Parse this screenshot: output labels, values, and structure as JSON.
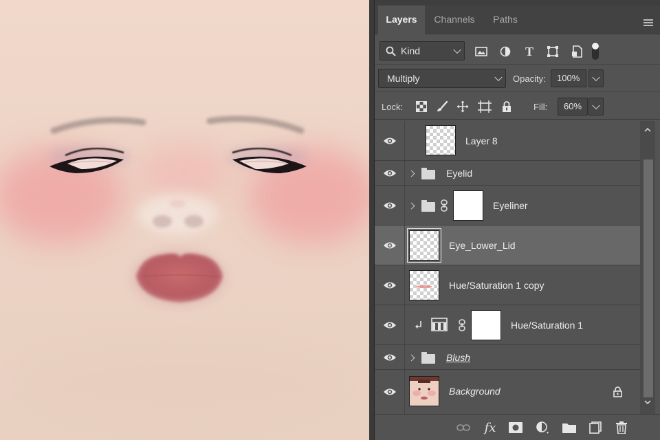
{
  "panel": {
    "tabs": [
      {
        "label": "Layers",
        "active": true
      },
      {
        "label": "Channels",
        "active": false
      },
      {
        "label": "Paths",
        "active": false
      }
    ],
    "filter": {
      "kind_label": "Kind",
      "filter_icons": [
        "image-filter-icon",
        "adjustment-filter-icon",
        "type-filter-icon",
        "shape-filter-icon",
        "smart-object-filter-icon",
        "filter-toggle-icon"
      ]
    },
    "blend": {
      "mode": "Multiply",
      "opacity_label": "Opacity:",
      "opacity_value": "100%"
    },
    "lock": {
      "label": "Lock:",
      "icons": [
        "lock-transparent-pixels-icon",
        "lock-image-pixels-icon",
        "lock-position-icon",
        "lock-artboard-icon",
        "lock-all-icon"
      ],
      "fill_label": "Fill:",
      "fill_value": "60%"
    },
    "layers": [
      {
        "name": "Layer 8",
        "kind": "pixel",
        "visible": true,
        "selected": false
      },
      {
        "name": "Eyelid",
        "kind": "group",
        "visible": true,
        "selected": false
      },
      {
        "name": "Eyeliner",
        "kind": "group-with-mask",
        "visible": true,
        "selected": false
      },
      {
        "name": "Eye_Lower_Lid",
        "kind": "pixel",
        "visible": true,
        "selected": true
      },
      {
        "name": "Hue/Saturation 1 copy",
        "kind": "pixel",
        "visible": true,
        "selected": false
      },
      {
        "name": "Hue/Saturation 1",
        "kind": "adjustment-clipped",
        "visible": true,
        "selected": false
      },
      {
        "name": "Blush",
        "kind": "group",
        "visible": true,
        "selected": false
      },
      {
        "name": "Background",
        "kind": "background-locked",
        "visible": true,
        "selected": false
      }
    ],
    "bottom_icons": [
      "link-layers-icon",
      "layer-style-icon",
      "add-mask-icon",
      "new-adjustment-layer-icon",
      "new-group-icon",
      "new-layer-icon",
      "delete-layer-icon"
    ],
    "layer_style_label": "fx"
  },
  "colors": {
    "panel_bg": "#535353",
    "selected_row": "#686868",
    "skin": "#ecd3c4",
    "blush": "#f0a4a4",
    "lips": "#c0646a"
  }
}
